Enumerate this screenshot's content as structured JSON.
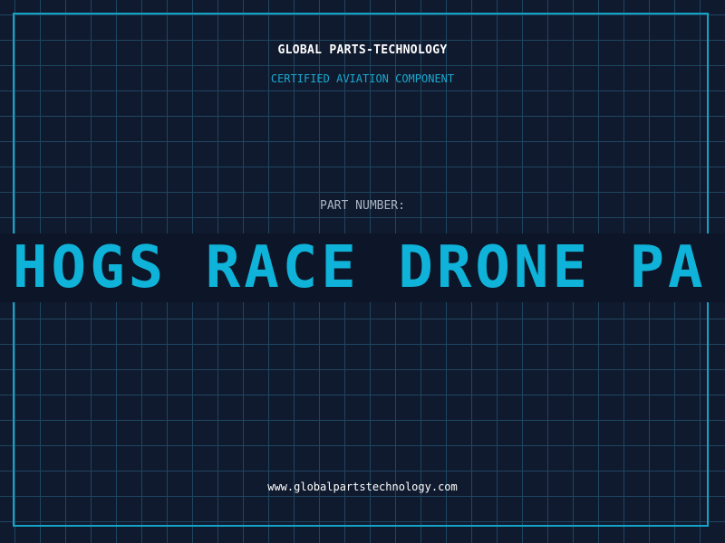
{
  "header": {
    "brand": "GLOBAL PARTS-TECHNOLOGY",
    "subtitle": "CERTIFIED AVIATION COMPONENT"
  },
  "part": {
    "label": "PART NUMBER:",
    "marquee_text": "HOGS RACE DRONE PA"
  },
  "footer": {
    "url": "www.globalpartstechnology.com"
  },
  "colors": {
    "background": "#101a2e",
    "grid": "#1f4560",
    "accent": "#14a3c7",
    "banner_text": "#0fb3d9",
    "banner_background": "#0d1628",
    "primary_text": "#ffffff",
    "muted_text": "#a9b6c6"
  }
}
